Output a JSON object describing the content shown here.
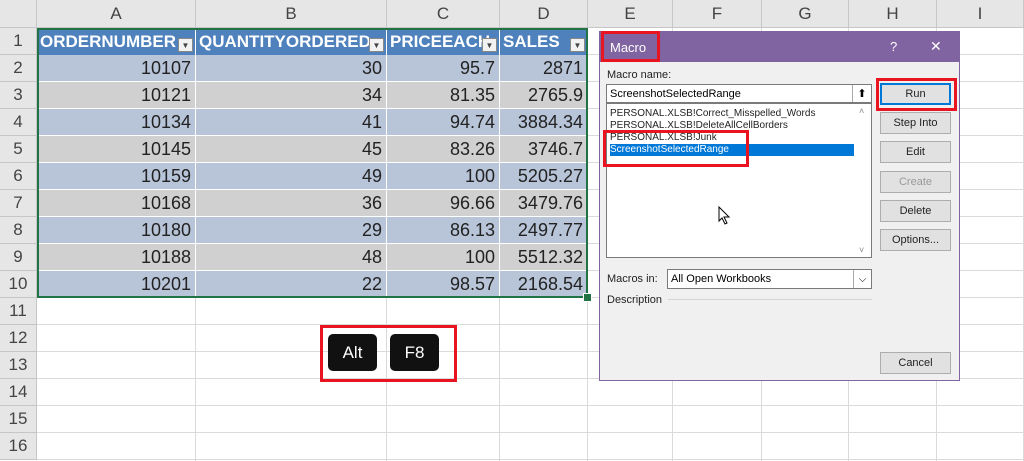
{
  "columns": [
    "A",
    "B",
    "C",
    "D",
    "E",
    "F",
    "G",
    "H",
    "I"
  ],
  "rows": [
    "1",
    "2",
    "3",
    "4",
    "5",
    "6",
    "7",
    "8",
    "9",
    "10",
    "11",
    "12",
    "13",
    "14",
    "15",
    "16"
  ],
  "table": {
    "headers": [
      "ORDERNUMBER",
      "QUANTITYORDERED",
      "PRICEEACH",
      "SALES"
    ],
    "data": [
      [
        "10107",
        "30",
        "95.7",
        "2871"
      ],
      [
        "10121",
        "34",
        "81.35",
        "2765.9"
      ],
      [
        "10134",
        "41",
        "94.74",
        "3884.34"
      ],
      [
        "10145",
        "45",
        "83.26",
        "3746.7"
      ],
      [
        "10159",
        "49",
        "100",
        "5205.27"
      ],
      [
        "10168",
        "36",
        "96.66",
        "3479.76"
      ],
      [
        "10180",
        "29",
        "86.13",
        "2497.77"
      ],
      [
        "10188",
        "48",
        "100",
        "5512.32"
      ],
      [
        "10201",
        "22",
        "98.57",
        "2168.54"
      ]
    ]
  },
  "keys": [
    "Alt",
    "F8"
  ],
  "dialog": {
    "title": "Macro",
    "help": "?",
    "close": "✕",
    "macro_name_label": "Macro name:",
    "macro_name_value": "ScreenshotSelectedRange",
    "macros": [
      "PERSONAL.XLSB!Correct_Misspelled_Words",
      "PERSONAL.XLSB!DeleteAllCellBorders",
      "PERSONAL.XLSB!Junk",
      "ScreenshotSelectedRange"
    ],
    "macros_in_label": "Macros in:",
    "macros_in_value": "All Open Workbooks",
    "description_label": "Description",
    "buttons": {
      "run": "Run",
      "step_into": "Step Into",
      "edit": "Edit",
      "create": "Create",
      "delete": "Delete",
      "options": "Options...",
      "cancel": "Cancel"
    }
  },
  "colors": {
    "table_header": "#4f81bd",
    "row_band_a": "#b8c4d8",
    "row_band_b": "#d0d0d0",
    "dialog_title": "#8064a2",
    "highlight": "#e8141f"
  }
}
